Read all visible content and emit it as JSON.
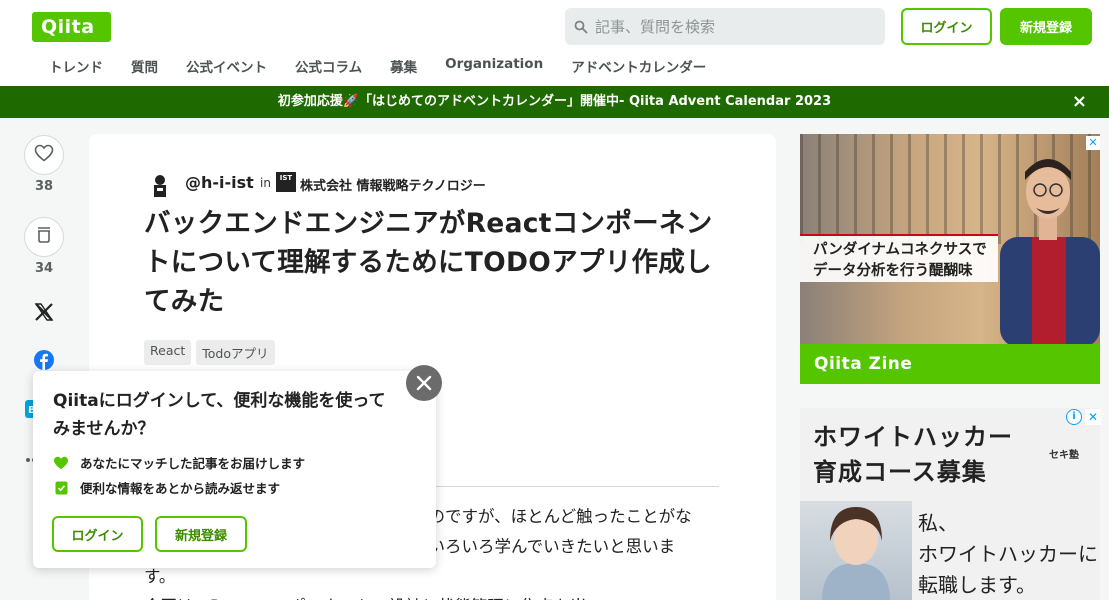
{
  "header": {
    "logo": "Qiita",
    "search_placeholder": "記事、質問を検索",
    "login": "ログイン",
    "signup": "新規登録",
    "nav": [
      "トレンド",
      "質問",
      "公式イベント",
      "公式コラム",
      "募集",
      "Organization",
      "アドベントカレンダー"
    ]
  },
  "banner": {
    "text": "初参加応援🚀「はじめてのアドベントカレンダー」開催中- Qiita Advent Calendar 2023",
    "close": "×"
  },
  "actions": {
    "likes": "38",
    "stocks": "34"
  },
  "article": {
    "author": "@h-i-ist",
    "in": "in",
    "org_logo": "IST",
    "org": "株式会社 情報戦略テクノロジー",
    "title": "バックエンドエンジニアがReactコンポーネントについて理解するためにTODOアプリ作成してみた",
    "tags": [
      "React",
      "Todoアプリ"
    ],
    "body": [
      "たのですが、ほとんど触ったことがな",
      "ていろいろ学んでいきたいと思いま",
      "す。",
      "今回は、Reactコンポーネントの設計と状態管理に焦点を当て"
    ]
  },
  "popup": {
    "title": "Qiitaにログインして、便利な機能を使ってみませんか？",
    "features": [
      "あなたにマッチした記事をお届けします",
      "便利な情報をあとから読み返せます"
    ],
    "login": "ログイン",
    "signup": "新規登録"
  },
  "ads": {
    "ad1_caption_line1_a": "パンダイナムコネクサス",
    "ad1_caption_line1_b": "で",
    "ad1_caption_line2_a": "データ分析",
    "ad1_caption_line2_b": "を行う醍醐味",
    "ad1_footer": "Qiita Zine",
    "ad2_title_line1": "ホワイトハッカー",
    "ad2_title_line2": "育成コース募集",
    "ad2_logo": "セキ塾",
    "ad2_hand": [
      "私、",
      "ホワイトハッカーに",
      "転職します。"
    ]
  },
  "colors": {
    "brand": "#55c500",
    "banner": "#1f6a00"
  }
}
